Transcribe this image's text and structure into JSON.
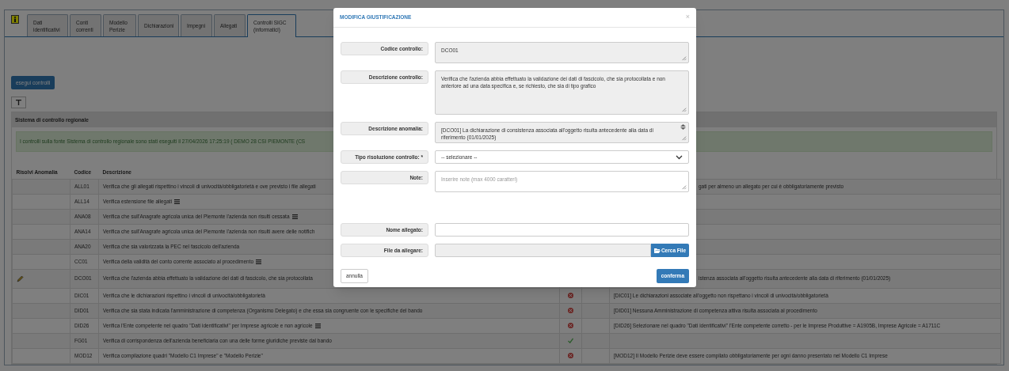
{
  "tabs": [
    {
      "label": "Dati identificativi",
      "selected": false
    },
    {
      "label": "Conti correnti",
      "selected": false
    },
    {
      "label": "Modello Perizie",
      "selected": false
    },
    {
      "label": "Dichiarazioni",
      "selected": false
    },
    {
      "label": "Impegni",
      "selected": false
    },
    {
      "label": "Allegati",
      "selected": false
    },
    {
      "label": "Controlli SIGC (informatici)",
      "selected": true
    }
  ],
  "run_button": "esegui controlli",
  "section_title": "Sistema di controllo regionale",
  "alert": "I controlli sulla fonte Sistema di controllo regionale sono stati eseguiti il 27/04/2026 17:25:19 ( DEMO 28 CSI PIEMONTE (CS",
  "table": {
    "columns": [
      "Risolvi Anomalia",
      "Codice",
      "Descrizione"
    ],
    "rows": [
      {
        "editable": false,
        "code": "ALL01",
        "description": "Verifica che gli allegati rispettino i vincoli di univocità/obbligatorietà e ove previsto i file allegati",
        "has_detail": false,
        "anomaly": "gati per almeno un allegato per cui è obbligatoriamente previsto",
        "anomaly_cut": true
      },
      {
        "editable": false,
        "code": "ALL14",
        "description": "Verifica estensione file allegati",
        "has_detail": true
      },
      {
        "editable": false,
        "code": "ANA08",
        "description": "Verifica che sull'Anagrafe agricola unica del Piemonte l'azienda non risulti cessata",
        "has_detail": true
      },
      {
        "editable": false,
        "code": "ANA14",
        "description": "Verifica che sull'Anagrafe agricola unica del Piemonte l'azienda non risulti avere delle notifich",
        "has_detail": false
      },
      {
        "editable": false,
        "code": "ANA20",
        "description": "Verifica che sia valorizzata la PEC nel fascicolo dell'azienda",
        "has_detail": false
      },
      {
        "editable": false,
        "code": "CC01",
        "description": "Verifica della validità del conto corrente associato al procedimento",
        "has_detail": true
      },
      {
        "editable": true,
        "code": "DCO01",
        "description": "Verifica che l'azienda abbia effettuato la validazione dei dati di fascicolo, che sia protocollata",
        "has_detail": false,
        "anomaly": "istenza associata all'oggetto risulta antecedente alla data di riferimento (01/01/2025)",
        "anomaly_cut": true
      },
      {
        "editable": false,
        "code": "DIC01",
        "description": "Verifica che le dichiarazioni rispettino i vincoli di univocità/obbligatorietà",
        "has_detail": false,
        "passed": false,
        "anomaly": "[DIC01] Le dichiarazioni associate all'oggetto non rispettano i vincoli di univocità/obbligatorietà",
        "anomaly_cut": false
      },
      {
        "editable": false,
        "code": "DID01",
        "description": "Verifica che sia stata indicata l'amministrazione di competenza (Organismo Delegato) e che essa sia congruente con le specifiche del bando",
        "has_detail": false,
        "passed": false,
        "anomaly": "[DID01] Nessuna Amministrazione di competenza attiva risulta associata al procedimento",
        "anomaly_cut": false
      },
      {
        "editable": false,
        "code": "DID26",
        "description": "Verifica l'Ente competente nel quadro \"Dati identificativi\" per Imprese agricole e non agricole",
        "has_detail": true,
        "passed": false,
        "anomaly": "[DID26] Selezionare nel quadro \"Dati identificativi\" l'Ente competente corretto - per le Imprese Produttive = A1905B, Imprese Agricole = A1711C",
        "anomaly_cut": false
      },
      {
        "editable": false,
        "code": "FG01",
        "description": "Verifica di corrispondenza dell'azienda beneficiaria con una delle forme giuridiche previste dal bando",
        "has_detail": false,
        "passed": true
      },
      {
        "editable": false,
        "code": "MOD12",
        "description": "Verifica compilazione quadri \"Modello C1 Imprese\" e \"Modello Perizie\"",
        "has_detail": false,
        "passed": false,
        "anomaly": "[MOD12] Il Modello Perizie deve essere compilato obbligatoriamente per ogni danno presentato nel Modello C1 Imprese",
        "anomaly_cut": false
      }
    ]
  },
  "modal": {
    "title": "MODIFICA GIUSTIFICAZIONE",
    "close": "×",
    "fields": [
      {
        "kind": "readonly",
        "label": "Codice controllo:",
        "value": "DCO01"
      },
      {
        "kind": "readonly_tall",
        "label": "Descrizione controllo:",
        "value": "Verifica che l'azienda abbia effettuato la validazione dei dati di fascicolo, che sia protocollata e non anteriore ad una data specifica e, se richiesto, che sia di tipo grafico"
      },
      {
        "kind": "readonly_scroll",
        "label": "Descrizione anomalia:",
        "value": "[DCO01] La dichiarazione di consistenza associata all'oggetto risulta antecedente alla data di riferimento (01/01/2025)"
      },
      {
        "kind": "select",
        "label": "Tipo risoluzione controllo: *",
        "value": "-- selezionare --"
      },
      {
        "kind": "textarea",
        "label": "Note:",
        "placeholder": "Inserire note (max 4000 caratteri)"
      },
      {
        "kind": "text",
        "label": "Nome allegato:"
      },
      {
        "kind": "file",
        "label": "File da allegare:",
        "button": "Cerca File"
      }
    ],
    "cancel": "annulla",
    "confirm": "conferma"
  }
}
